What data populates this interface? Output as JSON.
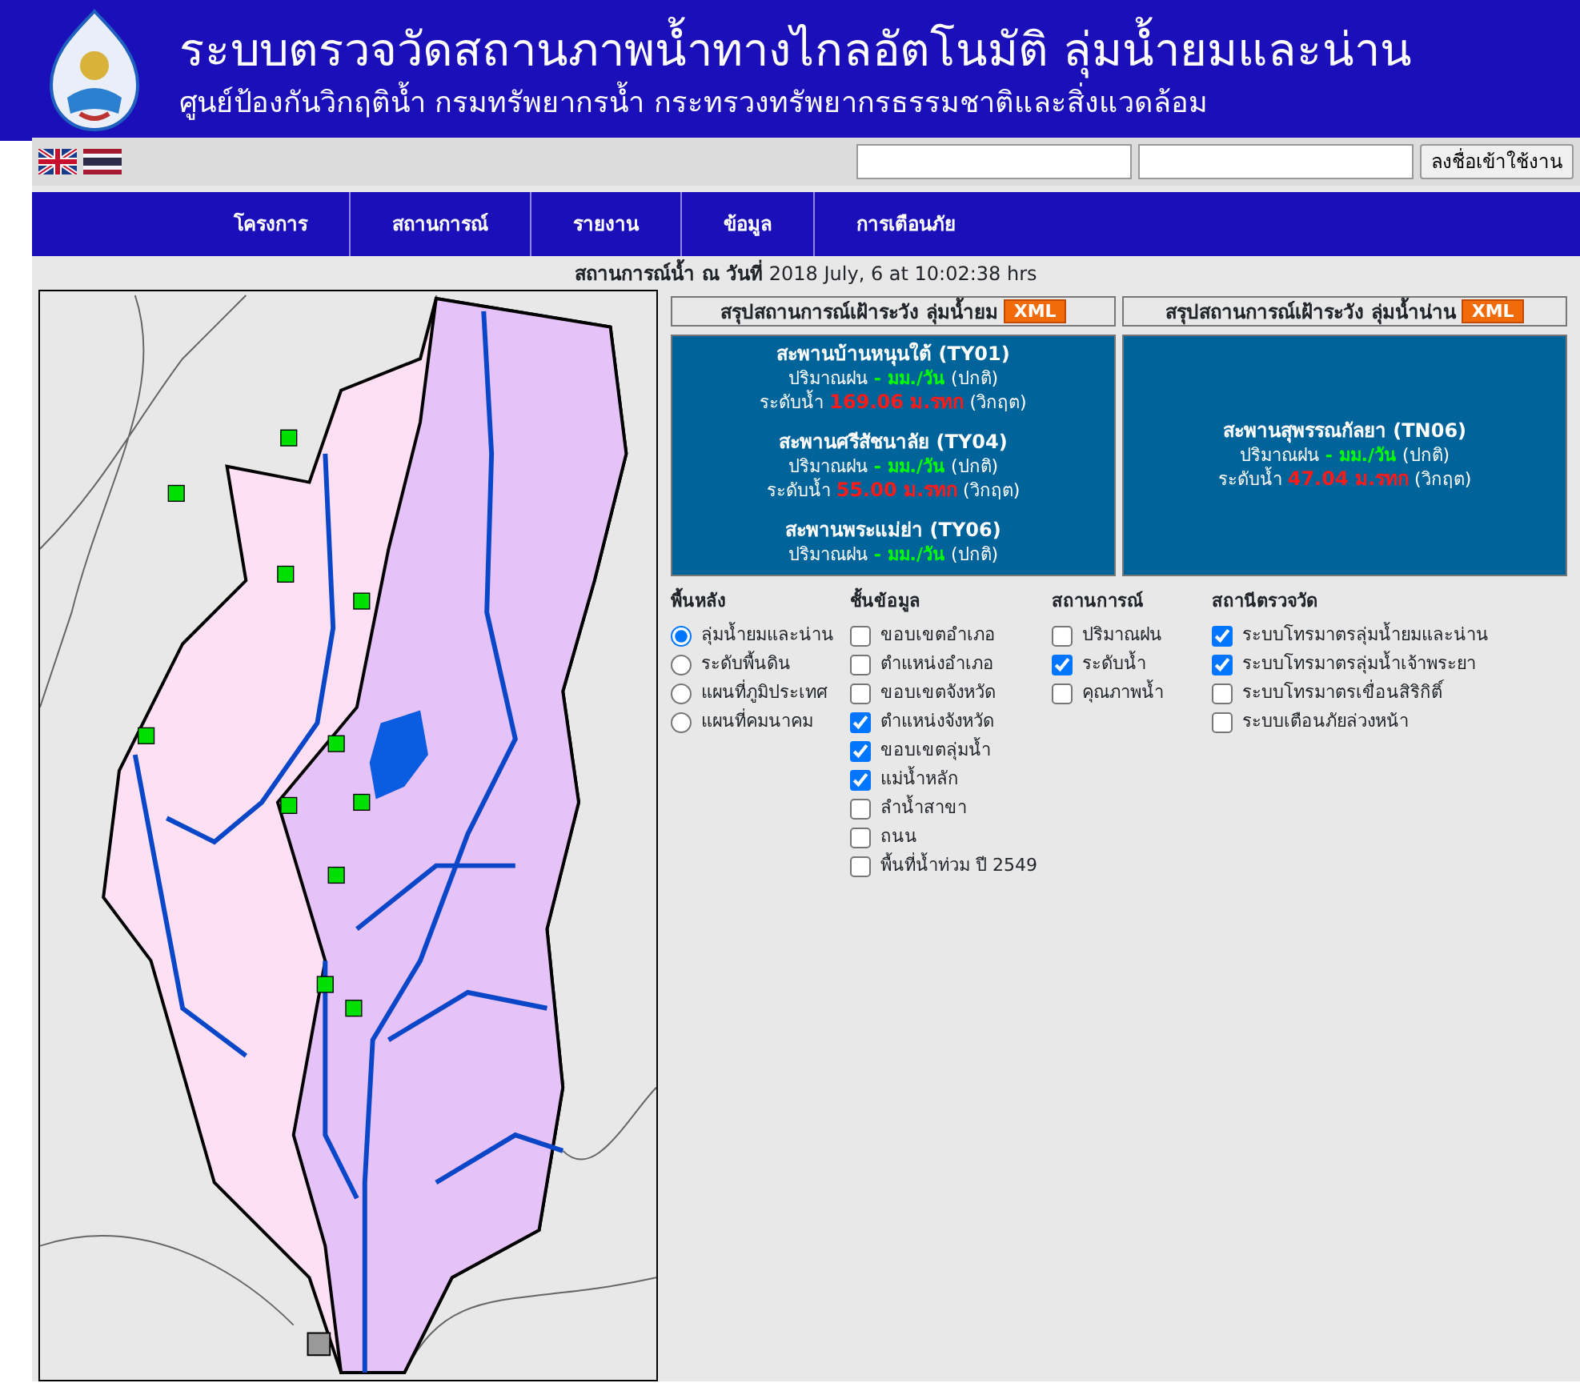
{
  "header": {
    "title": "ระบบตรวจวัดสถานภาพน้ำทางไกลอัตโนมัติ ลุ่มน้ำยมและน่าน",
    "subtitle": "ศูนย์ป้องกันวิกฤติน้ำ กรมทรัพยากรน้ำ กระทรวงทรัพยากรธรรมชาติและสิ่งแวดล้อม"
  },
  "login": {
    "button": "ลงชื่อเข้าใช้งาน"
  },
  "nav": [
    "โครงการ",
    "สถานการณ์",
    "รายงาน",
    "ข้อมูล",
    "การเตือนภัย"
  ],
  "date_line": "**สถานการณ์น้ำ ณ วันที่** 2018 July, 6 at 10:02:38 hrs",
  "panels": [
    {
      "title": "สรุปสถานการณ์เฝ้าระวัง ลุ่มน้ำยม",
      "badge": "XML",
      "stations": [
        {
          "name": "สะพานบ้านหนุนใต้ (TY01)",
          "rain": {
            "label": "ปริมาณฝน",
            "value": "- มม./วัน",
            "status": "(ปกติ)"
          },
          "level": {
            "label": "ระดับน้ำ",
            "value": "169.06 ม.รทก",
            "status": "(วิกฤต)"
          }
        },
        {
          "name": "สะพานศรีสัชนาลัย (TY04)",
          "rain": {
            "label": "ปริมาณฝน",
            "value": "- มม./วัน",
            "status": "(ปกติ)"
          },
          "level": {
            "label": "ระดับน้ำ",
            "value": "55.00 ม.รทก",
            "status": "(วิกฤต)"
          }
        },
        {
          "name": "สะพานพระแม่ย่า (TY06)",
          "rain": {
            "label": "ปริมาณฝน",
            "value": "- มม./วัน",
            "status": "(ปกติ)"
          }
        }
      ]
    },
    {
      "title": "สรุปสถานการณ์เฝ้าระวัง ลุ่มน้ำน่าน",
      "badge": "XML",
      "stations": [
        {
          "name": "สะพานสุพรรณกัลยา (TN06)",
          "rain": {
            "label": "ปริมาณฝน",
            "value": "- มม./วัน",
            "status": "(ปกติ)"
          },
          "level": {
            "label": "ระดับน้ำ",
            "value": "47.04 ม.รทก",
            "status": "(วิกฤต)"
          }
        }
      ]
    }
  ],
  "layers": [
    {
      "title": "พื้นหลัง",
      "kind": "radio",
      "items": [
        {
          "label": "ลุ่มน้ำยมและน่าน",
          "selected": true
        },
        {
          "label": "ระดับพื้นดิน",
          "selected": false
        },
        {
          "label": "แผนที่ภูมิประเทศ",
          "selected": false
        },
        {
          "label": "แผนที่คมนาคม",
          "selected": false
        }
      ]
    },
    {
      "title": "ชั้นข้อมูล",
      "kind": "checkbox",
      "items": [
        {
          "label": "ขอบเขตอำเภอ",
          "checked": false
        },
        {
          "label": "ตำแหน่งอำเภอ",
          "checked": false
        },
        {
          "label": "ขอบเขตจังหวัด",
          "checked": false
        },
        {
          "label": "ตำแหน่งจังหวัด",
          "checked": true
        },
        {
          "label": "ขอบเขตลุ่มน้ำ",
          "checked": true
        },
        {
          "label": "แม่น้ำหลัก",
          "checked": true
        },
        {
          "label": "ลำน้ำสาขา",
          "checked": false
        },
        {
          "label": "ถนน",
          "checked": false
        },
        {
          "label": "พื้นที่น้ำท่วม ปี 2549",
          "checked": false
        }
      ]
    },
    {
      "title": "สถานการณ์",
      "kind": "checkbox",
      "items": [
        {
          "label": "ปริมาณฝน",
          "checked": false
        },
        {
          "label": "ระดับน้ำ",
          "checked": true
        },
        {
          "label": "คุณภาพน้ำ",
          "checked": false
        }
      ]
    },
    {
      "title": "สถานีตรวจวัด",
      "kind": "checkbox",
      "items": [
        {
          "label": "ระบบโทรมาตรลุ่มน้ำยมและน่าน",
          "checked": true
        },
        {
          "label": "ระบบโทรมาตรลุ่มน้ำเจ้าพระยา",
          "checked": true
        },
        {
          "label": "ระบบโทรมาตรเขื่อนสิริกิติ์",
          "checked": false
        },
        {
          "label": "ระบบเตือนภัยล่วงหน้า",
          "checked": false
        }
      ]
    }
  ]
}
